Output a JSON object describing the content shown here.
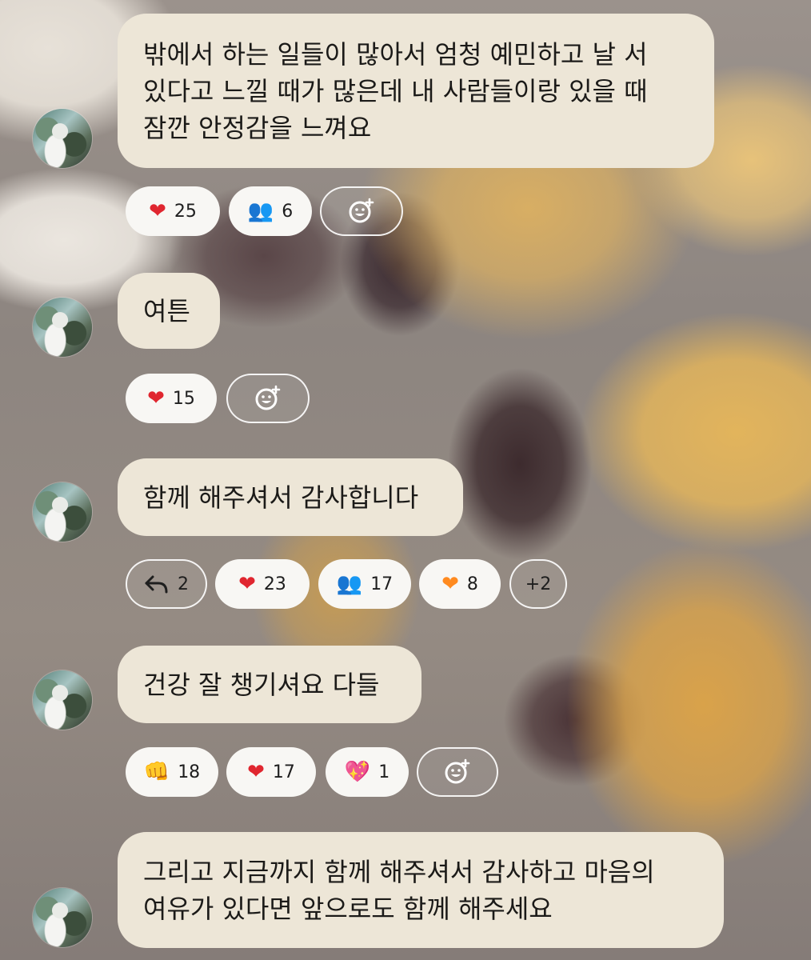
{
  "messages": [
    {
      "text": "밖에서 하는 일들이 많아서 엄청 예민하고 날 서\n있다고 느낄 때가 많은데 내 사람들이랑 있을 때\n잠깐 안정감을 느껴요",
      "reactions": [
        {
          "icon": "red-heart-icon",
          "glyph": "❤",
          "count": "25"
        },
        {
          "icon": "people-icon",
          "glyph": "👥",
          "count": "6"
        }
      ]
    },
    {
      "text": "여튼",
      "reactions": [
        {
          "icon": "red-heart-icon",
          "glyph": "❤",
          "count": "15"
        }
      ]
    },
    {
      "text": "함께 해주셔서 감사합니다",
      "reactions": [
        {
          "icon": "reply-icon",
          "count": "2"
        },
        {
          "icon": "red-heart-icon",
          "glyph": "❤",
          "count": "23"
        },
        {
          "icon": "people-icon",
          "glyph": "👥",
          "count": "17"
        },
        {
          "icon": "orange-heart-icon",
          "glyph": "❤",
          "count": "8"
        },
        {
          "more": "+2"
        }
      ]
    },
    {
      "text": "건강 잘 챙기셔요 다들",
      "reactions": [
        {
          "icon": "fist-bump-icon",
          "glyph": "👊",
          "count": "18"
        },
        {
          "icon": "red-heart-icon",
          "glyph": "❤",
          "count": "17"
        },
        {
          "icon": "sparkling-heart-icon",
          "glyph": "💖",
          "count": "1"
        }
      ]
    },
    {
      "text": "그리고 지금까지 함께 해주셔서 감사하고 마음의\n여유가 있다면 앞으로도 함께 해주세요",
      "reactions": []
    }
  ],
  "colors": {
    "bubble": "#ede6d7",
    "pill": "#f8f7f4",
    "heart": "#e0262f",
    "orange_heart": "#ff8a1f"
  }
}
